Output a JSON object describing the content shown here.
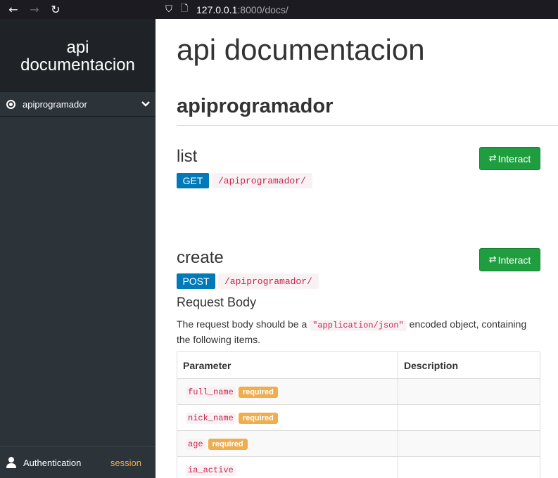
{
  "browser": {
    "back_icon": "arrow-left-icon",
    "forward_icon": "arrow-right-icon",
    "reload_icon": "reload-icon",
    "url_host": "127.0.0.1",
    "url_rest": ":8000/docs/"
  },
  "sidebar": {
    "brand_line1": "api",
    "brand_line2": "documentacion",
    "items": [
      {
        "label": "apiprogramador",
        "icon": "radio-dot-icon",
        "expanded": true
      }
    ],
    "auth_label": "Authentication",
    "auth_value": "session"
  },
  "main": {
    "title": "api documentacion",
    "section": "apiprogramador",
    "endpoints": [
      {
        "name": "list",
        "method": "GET",
        "path": "/apiprogramador/",
        "button": "Interact"
      },
      {
        "name": "create",
        "method": "POST",
        "path": "/apiprogramador/",
        "button": "Interact"
      }
    ],
    "request_body": {
      "title": "Request Body",
      "desc_before": "The request body should be a ",
      "desc_code": "\"application/json\"",
      "desc_after": " encoded object, containing the following items."
    },
    "params_table": {
      "headers": [
        "Parameter",
        "Description"
      ],
      "rows": [
        {
          "name": "full_name",
          "badge": "required",
          "description": ""
        },
        {
          "name": "nick_name",
          "badge": "required",
          "description": ""
        },
        {
          "name": "age",
          "badge": "required",
          "description": ""
        },
        {
          "name": "ia_active",
          "badge": "",
          "description": ""
        }
      ]
    }
  },
  "colors": {
    "sidebar_bg": "#2c3339",
    "brand_bg": "#1f2327",
    "interact_green": "#1e9e3e",
    "method_blue": "#0079b8",
    "code_red": "#c7254e",
    "required_orange": "#f0ad4e"
  }
}
